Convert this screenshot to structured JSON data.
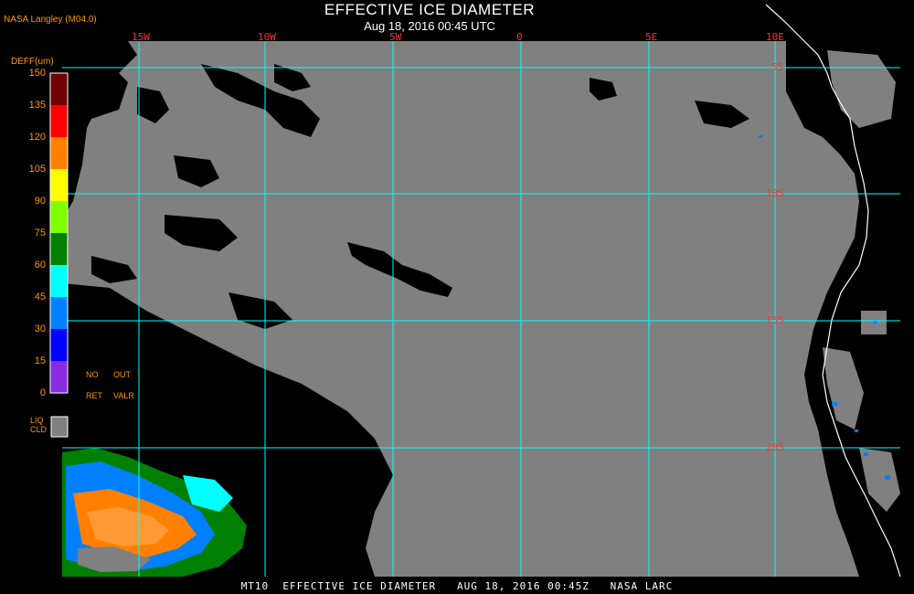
{
  "header": {
    "title": "EFFECTIVE ICE DIAMETER",
    "timestamp": "Aug 18, 2016 00:45 UTC",
    "source": "NASA Langley (M04.0)"
  },
  "legend": {
    "title": "DEFF(um)",
    "ticks": [
      "150",
      "135",
      "120",
      "105",
      "90",
      "75",
      "60",
      "45",
      "30",
      "15",
      "0"
    ],
    "colors": [
      "#6e0000",
      "#ff0000",
      "#ff8000",
      "#ffff00",
      "#80ff00",
      "#008000",
      "#00ffff",
      "#0080ff",
      "#0000ff",
      "#8a2be2"
    ],
    "no_ret_labels": [
      "NO",
      "RET"
    ],
    "out_valr_labels": [
      "OUT",
      "VALR"
    ],
    "liq_cld_labels": [
      "LIQ",
      "CLD"
    ],
    "liq_cld_color": "#808080",
    "clear_color": "#000000"
  },
  "grid": {
    "color": "#00ffff",
    "lon_labels": [
      "15W",
      "10W",
      "5W",
      "0",
      "5E",
      "10E"
    ],
    "lat_labels": [
      "5S",
      "10S",
      "15S",
      "20S"
    ]
  },
  "footer": {
    "text": "MT10  EFFECTIVE ICE DIAMETER   AUG 18, 2016 00:45Z   NASA LARC"
  }
}
